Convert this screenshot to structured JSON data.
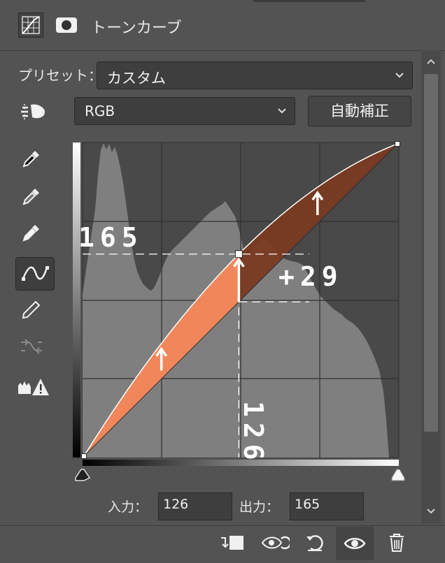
{
  "header": {
    "title": "トーンカーブ"
  },
  "preset": {
    "label": "プリセット：",
    "value": "カスタム"
  },
  "channel": {
    "value": "RGB",
    "auto_button": "自動補正"
  },
  "annotations": {
    "output_value": "165",
    "delta": "+29",
    "input_value": "126"
  },
  "io": {
    "input_label": "入力：",
    "input_value": "126",
    "output_label": "出力：",
    "output_value": "165"
  },
  "chart_data": {
    "type": "line",
    "x": [
      0,
      255
    ],
    "xlim": [
      0,
      255
    ],
    "ylim": [
      0,
      255
    ],
    "series": [
      {
        "x": [
          0,
          126,
          255
        ],
        "values": [
          0,
          165,
          255
        ]
      },
      {
        "x": [
          0,
          255
        ],
        "values": [
          0,
          255
        ]
      }
    ],
    "grid": "4x4"
  },
  "colors": {
    "panel": "#535353",
    "fill": "#f0865a",
    "fill_dark": "#7a3a22",
    "histogram": "#7f7f7f"
  },
  "icons": {
    "tab1": "curves-grid-icon",
    "tab2": "mask-icon",
    "target": "targeted-adjustment-icon",
    "eyedropper_black": "eyedropper-black-icon",
    "eyedropper_gray": "eyedropper-gray-icon",
    "eyedropper_white": "eyedropper-white-icon",
    "curve": "curve-point-tool-icon",
    "pencil": "pencil-icon",
    "smooth": "smooth-curve-icon",
    "clip": "clipping-warning-icon"
  }
}
